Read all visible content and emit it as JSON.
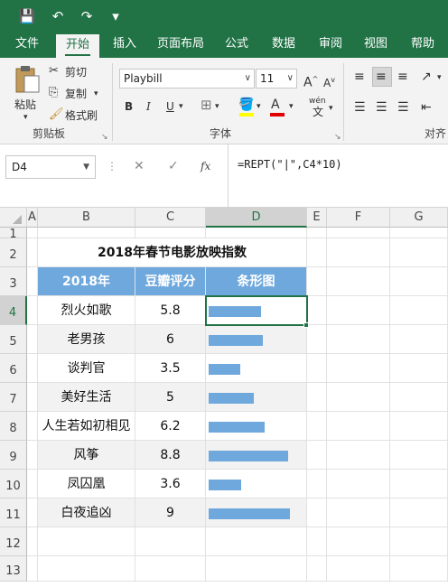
{
  "quick_access": {
    "save_icon": "💾",
    "undo_icon": "↶",
    "redo_icon": "↷",
    "customize_icon": "▾"
  },
  "tabs": [
    {
      "label": "文件"
    },
    {
      "label": "开始"
    },
    {
      "label": "插入"
    },
    {
      "label": "页面布局"
    },
    {
      "label": "公式"
    },
    {
      "label": "数据"
    },
    {
      "label": "审阅"
    },
    {
      "label": "视图"
    },
    {
      "label": "帮助"
    }
  ],
  "ribbon": {
    "paste_label": "粘贴",
    "cut_label": "剪切",
    "copy_label": "复制",
    "format_painter_label": "格式刷",
    "clipboard_group": "剪贴板",
    "font_name": "Playbill",
    "font_size": "11",
    "font_group": "字体",
    "bold": "B",
    "italic": "I",
    "underline": "U",
    "grow_font": "A",
    "shrink_font": "A",
    "font_color_letter": "A",
    "wen_label": "wén",
    "wen_char": "文",
    "align_group": "对齐"
  },
  "formula_bar": {
    "name_box": "D4",
    "cancel": "✕",
    "enter": "✓",
    "fx": "fx",
    "formula": "=REPT(\"|\",C4*10)"
  },
  "columns": [
    "A",
    "B",
    "C",
    "D",
    "E",
    "F",
    "G"
  ],
  "rows": [
    "1",
    "2",
    "3",
    "4",
    "5",
    "6",
    "7",
    "8",
    "9",
    "10",
    "11",
    "12",
    "13"
  ],
  "sheet": {
    "title": "2018年春节电影放映指数",
    "headers": [
      "2018年",
      "豆瓣评分",
      "条形图"
    ],
    "movies": [
      {
        "name": "烈火如歌",
        "score": "5.8",
        "value": 5.8
      },
      {
        "name": "老男孩",
        "score": "6",
        "value": 6
      },
      {
        "name": "谈判官",
        "score": "3.5",
        "value": 3.5
      },
      {
        "name": "美好生活",
        "score": "5",
        "value": 5
      },
      {
        "name": "人生若如初相见",
        "score": "6.2",
        "value": 6.2
      },
      {
        "name": "风筝",
        "score": "8.8",
        "value": 8.8
      },
      {
        "name": "凤囚凰",
        "score": "3.6",
        "value": 3.6
      },
      {
        "name": "白夜追凶",
        "score": "9",
        "value": 9
      }
    ]
  },
  "colors": {
    "header_fill": "#6fa8dc",
    "band_fill": "#f2f2f2",
    "bar": "#6fa8dc",
    "excel_green": "#217346"
  }
}
